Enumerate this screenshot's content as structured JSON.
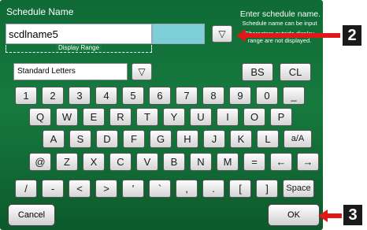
{
  "header": {
    "title": "Schedule Name",
    "help_line1": "Enter schedule name.",
    "help_line2": "Schedule name can be input",
    "help_line3": "Characters outside display",
    "help_line4": "range are not displayed."
  },
  "name_input": {
    "value": "scdlname5",
    "range_label": "Display Range"
  },
  "charset": {
    "selected": "Standard Letters"
  },
  "keys": {
    "bs": "BS",
    "cl": "CL",
    "row1": [
      "1",
      "2",
      "3",
      "4",
      "5",
      "6",
      "7",
      "8",
      "9",
      "0",
      "_"
    ],
    "row2": [
      "Q",
      "W",
      "E",
      "R",
      "T",
      "Y",
      "U",
      "I",
      "O",
      "P"
    ],
    "row3": [
      "A",
      "S",
      "D",
      "F",
      "G",
      "H",
      "J",
      "K",
      "L",
      "a/A"
    ],
    "row4": [
      "@",
      "Z",
      "X",
      "C",
      "V",
      "B",
      "N",
      "M",
      "=",
      "←",
      "→"
    ],
    "row5": [
      "/",
      "-",
      "<",
      ">",
      "'",
      "`",
      ",",
      ".",
      "[",
      "]",
      "Space"
    ]
  },
  "buttons": {
    "cancel": "Cancel",
    "ok": "OK",
    "dropdown_glyph": "▽"
  },
  "callouts": {
    "first": "2",
    "second": "3"
  }
}
